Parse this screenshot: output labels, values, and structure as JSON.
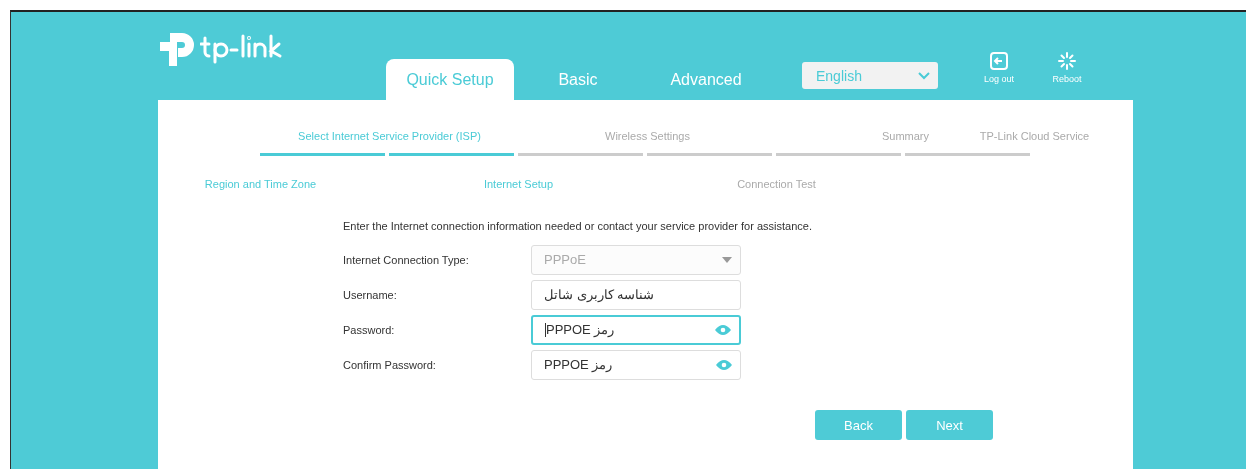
{
  "nav": {
    "tabs": [
      {
        "label": "Quick Setup",
        "selected": true
      },
      {
        "label": "Basic",
        "selected": false
      },
      {
        "label": "Advanced",
        "selected": false
      }
    ],
    "language": "English",
    "actions": [
      {
        "kind": "logout",
        "label": "Log out"
      },
      {
        "kind": "reboot",
        "label": "Reboot"
      }
    ]
  },
  "steps": [
    {
      "label": "Region and Time Zone",
      "kind": "lower",
      "done": true
    },
    {
      "label": "Select Internet Service Provider (ISP)",
      "kind": "upper",
      "done": true
    },
    {
      "label": "Internet Setup",
      "kind": "lower",
      "done": true
    },
    {
      "label": "Wireless Settings",
      "kind": "upper",
      "done": false
    },
    {
      "label": "Connection Test",
      "kind": "lower",
      "done": false
    },
    {
      "label": "Summary",
      "kind": "upper",
      "done": false
    },
    {
      "label": "TP-Link Cloud Service",
      "kind": "upper",
      "done": false
    }
  ],
  "form": {
    "intro": "Enter the Internet connection information needed or contact your service provider for assistance.",
    "fields": [
      {
        "kind": "select",
        "label": "Internet Connection Type:",
        "value": "PPPoE",
        "focused": false,
        "disabled": true
      },
      {
        "kind": "text",
        "label": "Username:",
        "value": "شناسه کاربری شاتل",
        "focused": false
      },
      {
        "kind": "password",
        "label": "Password:",
        "value": "PPPOE رمز",
        "focused": true
      },
      {
        "kind": "password",
        "label": "Confirm Password:",
        "value": "PPPOE رمز",
        "focused": false
      }
    ]
  },
  "buttons": [
    "Back",
    "Next"
  ]
}
